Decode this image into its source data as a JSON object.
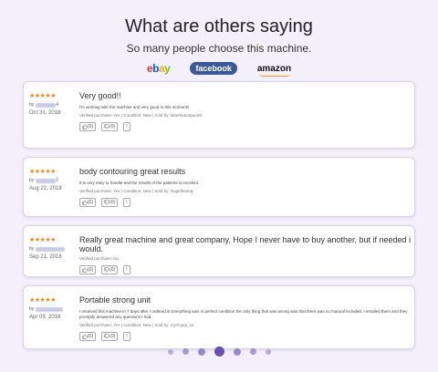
{
  "header": {
    "title": "What are others saying",
    "subtitle": "So many people choose this machine."
  },
  "brands": {
    "ebay": "ebay",
    "facebook": "facebook",
    "amazon": "amazon"
  },
  "reviews": [
    {
      "stars": "★★★★★",
      "by": "by",
      "user_suffix": "4",
      "date": "Oct 31, 2018",
      "title": "Very good!!",
      "text": "I'm working with the machine and very good in this moment!!",
      "verified": "Verified purchase: Yes | Condition: New | Sold by: laserbeautyworld",
      "helpful": "(0)",
      "not_helpful": "(0)",
      "report": "!"
    },
    {
      "stars": "★★★★★",
      "by": "by",
      "user_suffix": "2",
      "date": "Aug 22, 2018",
      "title": "body contouring great results",
      "text": "It is very easy to handle and the results of the patients is excelent",
      "verified": "Verified purchase: Yes | Condition: New | Sold by: ihygirlbeauty",
      "helpful": "(0)",
      "not_helpful": "(0)",
      "report": "!"
    },
    {
      "stars": "★★★★★",
      "by": "by",
      "user_suffix": "",
      "date": "Sep 21, 2016",
      "title": "Really great machine and great company, Hope I never have to buy another, but if needed i would.",
      "text": "",
      "verified": "Verified purchase: No",
      "helpful": "(0)",
      "not_helpful": "(0)",
      "report": "!"
    },
    {
      "stars": "★★★★★",
      "by": "by",
      "user_suffix": "",
      "date": "Apr 09, 2016",
      "title": "Portable strong unit",
      "text": "I received this machine in 7 days after I ordered it!  Everything was in perfect condition the only thing that was wrong was that there was no manual included.  I emailed them and they promptly answered any questions I had.",
      "verified": "Verified purchase: Yes | Condition: New | Sold by: mychoep_us",
      "helpful": "(0)",
      "not_helpful": "(0)",
      "report": "!"
    }
  ],
  "pagination": {
    "count": 7,
    "active_index": 3
  }
}
